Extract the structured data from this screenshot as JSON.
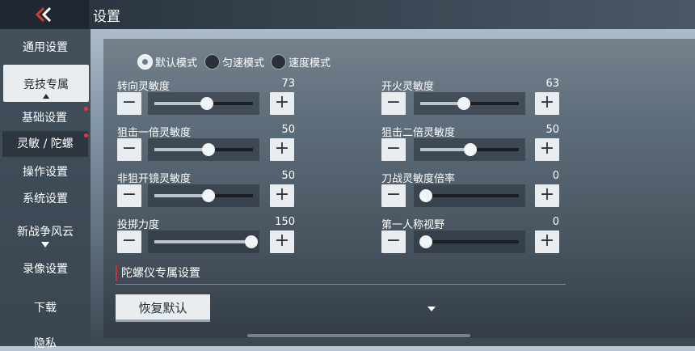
{
  "header": {
    "title": "设置"
  },
  "sidebar": {
    "items": [
      {
        "label": "通用设置"
      },
      {
        "label": "竞技专属"
      },
      {
        "label": "基础设置"
      },
      {
        "label": "灵敏 / 陀螺"
      },
      {
        "label": "操作设置"
      },
      {
        "label": "系统设置"
      },
      {
        "label": "新战争风云"
      },
      {
        "label": "录像设置"
      },
      {
        "label": "下载"
      },
      {
        "label": "隐私"
      }
    ]
  },
  "modes": [
    {
      "label": "默认模式",
      "selected": true
    },
    {
      "label": "匀速模式",
      "selected": false
    },
    {
      "label": "速度模式",
      "selected": false
    }
  ],
  "sliders": {
    "turn": {
      "label": "转向灵敏度",
      "value": "73"
    },
    "fire": {
      "label": "开火灵敏度",
      "value": "63"
    },
    "sniper1": {
      "label": "狙击一倍灵敏度",
      "value": "50"
    },
    "sniper2": {
      "label": "狙击二倍灵敏度",
      "value": "50"
    },
    "nonsniper": {
      "label": "非狙开镜灵敏度",
      "value": "50"
    },
    "knife": {
      "label": "刀战灵敏度倍率",
      "value": "0"
    },
    "throw": {
      "label": "投掷力度",
      "value": "150"
    },
    "fov": {
      "label": "第一人称视野",
      "value": "0"
    }
  },
  "buttons": {
    "minus": "−",
    "plus": "+"
  },
  "gyro": {
    "title": "陀螺仪专属设置"
  },
  "reset": {
    "label": "恢复默认"
  }
}
